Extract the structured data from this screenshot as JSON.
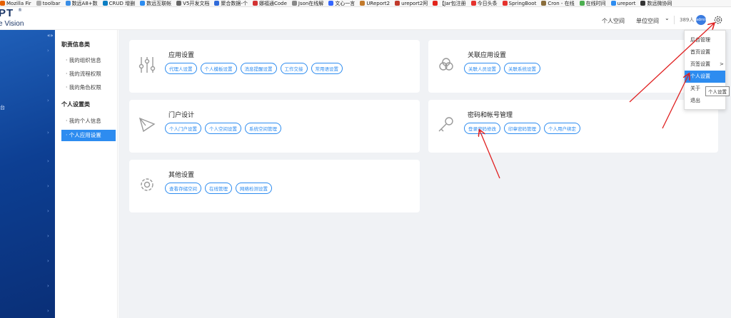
{
  "bookmarks": [
    {
      "label": "Mozilla Fir",
      "color": "#e66000"
    },
    {
      "label": "toolbar",
      "color": "#aaaaaa"
    },
    {
      "label": "数远A8+数",
      "color": "#3a8ee6"
    },
    {
      "label": "CRUD 增删",
      "color": "#0b7dc2"
    },
    {
      "label": "数远互联帐",
      "color": "#2d8cf0"
    },
    {
      "label": "V5开发文档",
      "color": "#666666"
    },
    {
      "label": "聚合数据-个",
      "color": "#2f6ad9"
    },
    {
      "label": "娜福通Code",
      "color": "#d23232"
    },
    {
      "label": "Json在线解",
      "color": "#888888"
    },
    {
      "label": "文心一言",
      "color": "#3366ff"
    },
    {
      "label": "UReport2",
      "color": "#c27a2c"
    },
    {
      "label": "ureport2阿",
      "color": "#c0392b"
    },
    {
      "label": "【Jar包注册",
      "color": "#e2231a"
    },
    {
      "label": "今日头条",
      "color": "#e5322d"
    },
    {
      "label": "SpringBoot",
      "color": "#e5322d"
    },
    {
      "label": "Cron - 在线",
      "color": "#8a6d3b"
    },
    {
      "label": "在线时间",
      "color": "#4caf50"
    },
    {
      "label": "ureport",
      "color": "#2d8cf0"
    },
    {
      "label": "数远微协同",
      "color": "#333333"
    }
  ],
  "header": {
    "logo_line1": "PT",
    "logo_reg": "®",
    "logo_line2": "e Vision",
    "personal_space": "个人空间",
    "unit_space": "单位空间",
    "unit_caret": "⌄",
    "user_count": "389人",
    "avatar_text": "admin"
  },
  "nav": {
    "collapse": "«»",
    "stub_text": "台"
  },
  "submenu": {
    "groups": [
      {
        "title": "职责信息类",
        "items": [
          "我的组织信息",
          "我的流程权限",
          "我的角色权限"
        ]
      },
      {
        "title": "个人设置类",
        "items": [
          "我的个人信息",
          "个人应用设置"
        ]
      }
    ],
    "active": "个人应用设置"
  },
  "cards": {
    "app": {
      "title": "应用设置",
      "tags": [
        "代理人设置",
        "个人模板设置",
        "消息提醒设置",
        "工作交接",
        "常用语设置"
      ]
    },
    "related": {
      "title": "关联应用设置",
      "tags": [
        "关联人员设置",
        "关联系统设置"
      ]
    },
    "portal": {
      "title": "门户设计",
      "tags": [
        "个人门户设置",
        "个人空间设置",
        "系统空间管理"
      ]
    },
    "password": {
      "title": "密码和帐号管理",
      "tags": [
        "登录密码修改",
        "印章密码管理",
        "个人用户绑定"
      ]
    },
    "other": {
      "title": "其他设置",
      "tags": [
        "查看存储空间",
        "在线管理",
        "网络检测设置"
      ]
    }
  },
  "dropdown": {
    "items": [
      "后台管理",
      "首页设置",
      "页签设置",
      "个人设置",
      "关于",
      "退出"
    ],
    "selected": "个人设置",
    "submenu_caret": ">",
    "tooltip": "个人设置"
  }
}
